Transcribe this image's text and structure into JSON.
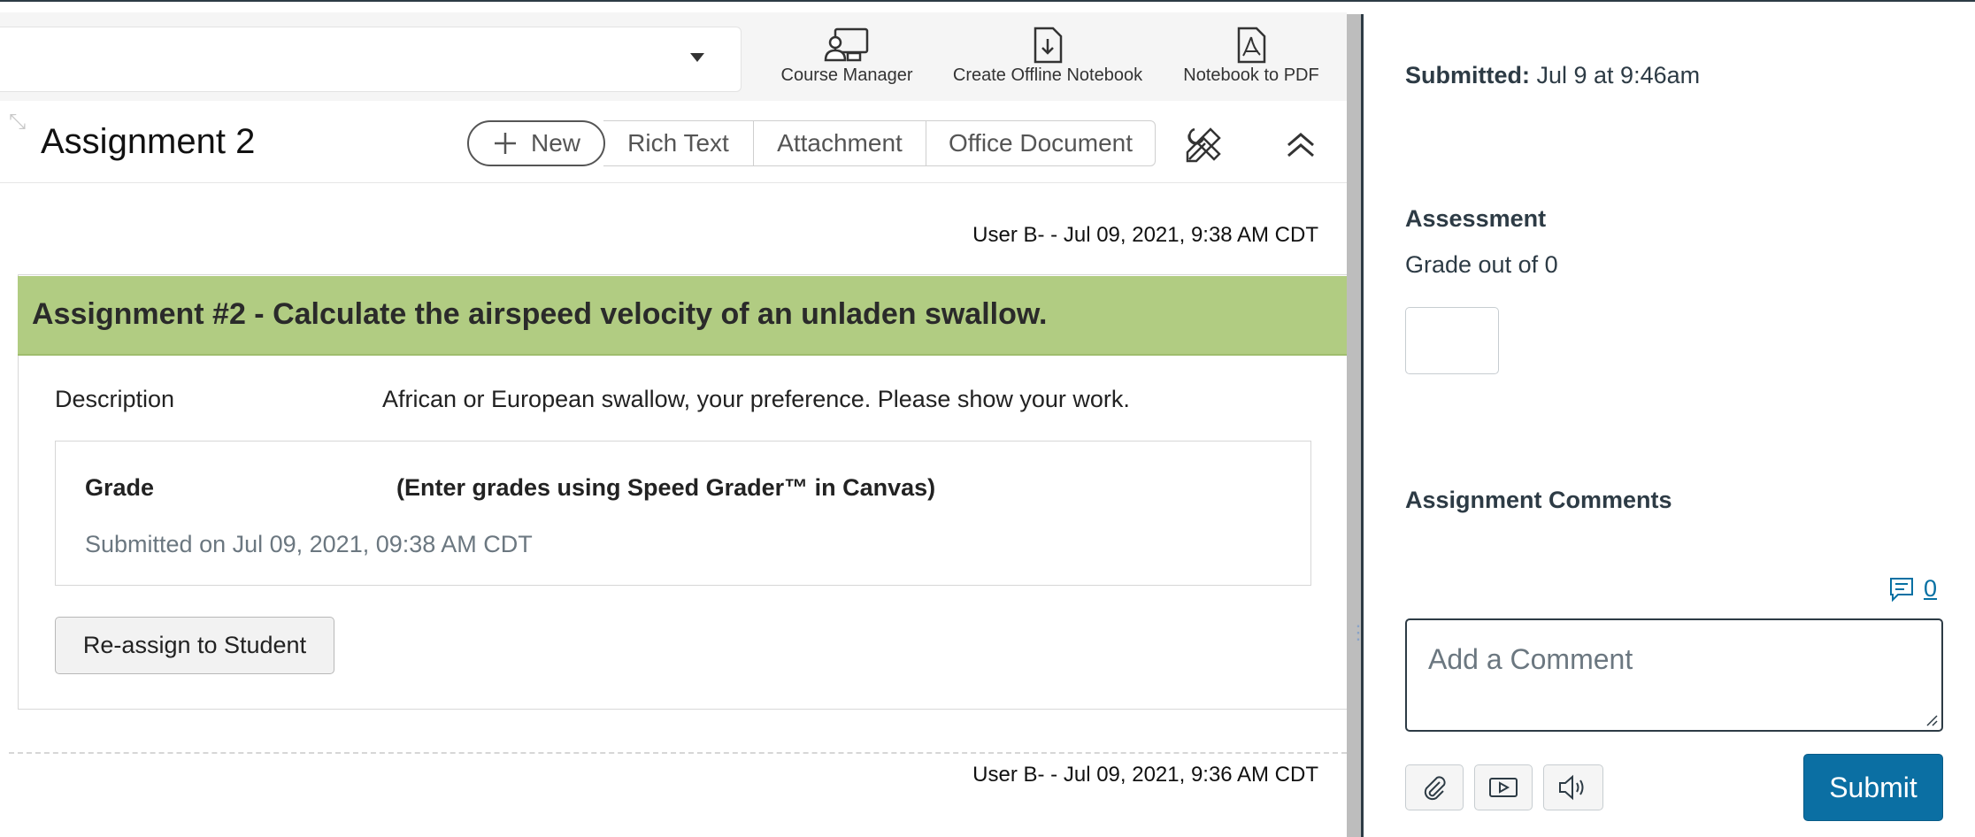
{
  "toolbar": {
    "course_manager": "Course Manager",
    "offline_notebook": "Create Offline Notebook",
    "notebook_pdf": "Notebook to PDF"
  },
  "page": {
    "title": "Assignment 2",
    "new_label": "New",
    "rich_text": "Rich Text",
    "attachment": "Attachment",
    "office_document": "Office Document"
  },
  "entries": [
    {
      "meta": "User B- - Jul 09, 2021, 9:38 AM CDT"
    },
    {
      "meta": "User B- - Jul 09, 2021, 9:36 AM CDT"
    }
  ],
  "assignment": {
    "banner": "Assignment #2 - Calculate the airspeed velocity of an unladen swallow.",
    "description_label": "Description",
    "description_value": "African or European swallow, your preference. Please show your work.",
    "grade_label": "Grade",
    "grade_note": "(Enter grades using Speed Grader™ in Canvas)",
    "submitted_on": "Submitted on Jul 09, 2021, 09:38 AM CDT",
    "reassign_label": "Re-assign to Student"
  },
  "sidebar": {
    "submitted_label": "Submitted:",
    "submitted_value": " Jul 9 at 9:46am",
    "assessment_heading": "Assessment",
    "grade_out_of": "Grade out of 0",
    "comments_heading": "Assignment Comments",
    "comment_count": "0",
    "comment_placeholder": "Add a Comment",
    "submit_label": "Submit"
  },
  "colors": {
    "banner": "#b1cc82",
    "submit": "#0b6fa3",
    "link": "#0770a3"
  },
  "icons": [
    "course-manager-icon",
    "offline-notebook-icon",
    "pdf-icon",
    "plus-icon",
    "tools-icon",
    "collapse-up-icon",
    "resize-icon",
    "comment-icon",
    "paperclip-icon",
    "media-icon",
    "audio-icon",
    "dropdown-caret-icon"
  ]
}
